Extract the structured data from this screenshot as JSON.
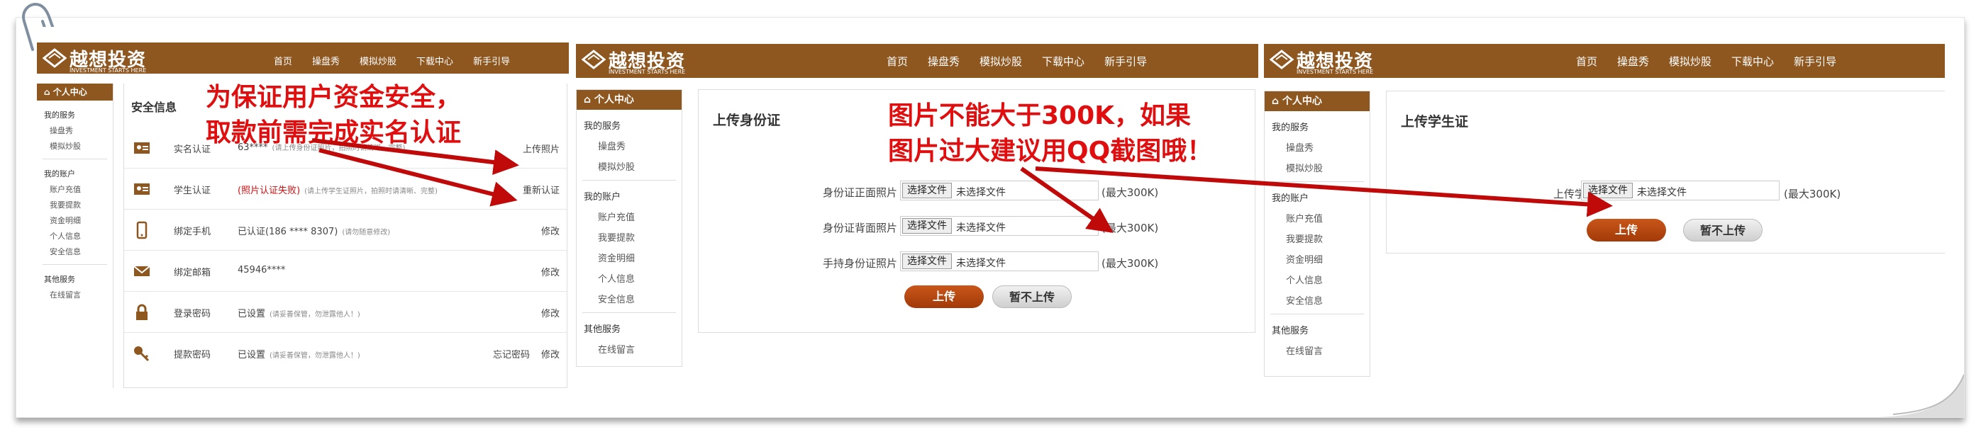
{
  "brand": {
    "name": "越想投资",
    "slogan": "INVESTMENT STARTS HERE",
    "color": "#8e5720"
  },
  "nav": [
    "首页",
    "操盘秀",
    "模拟炒股",
    "下载中心",
    "新手引导"
  ],
  "sidebar": {
    "header": "个人中心",
    "groups": [
      {
        "title": "我的服务",
        "items": [
          "操盘秀",
          "模拟炒股"
        ]
      },
      {
        "title": "我的账户",
        "items": [
          "账户充值",
          "我要提款",
          "资金明细",
          "个人信息",
          "安全信息"
        ]
      },
      {
        "title": "其他服务",
        "items": [
          "在线留言"
        ]
      }
    ]
  },
  "security": {
    "title": "安全信息",
    "rows": [
      {
        "icon": "id-card-icon",
        "label": "实名认证",
        "value": "63****",
        "note": "(请上传身份证照片，拍照时请清晰、完整)",
        "action": "上传照片"
      },
      {
        "icon": "student-card-icon",
        "label": "学生认证",
        "value": "(照片认证失败)",
        "note": "(请上传学生证照片，拍照时请清晰、完整)",
        "action": "重新认证"
      },
      {
        "icon": "phone-icon",
        "label": "绑定手机",
        "value": "已认证(186 **** 8307)",
        "note": "(请勿随意修改)",
        "action": "修改"
      },
      {
        "icon": "mail-icon",
        "label": "绑定邮箱",
        "value": "45946****",
        "note": "",
        "action": "修改"
      },
      {
        "icon": "lock-icon",
        "label": "登录密码",
        "value": "已设置",
        "note": "(请妥善保管，勿泄露他人！)",
        "action": "修改"
      },
      {
        "icon": "key-icon",
        "label": "提款密码",
        "value": "已设置",
        "note": "(请妥善保管，勿泄露他人！)",
        "action": "修改",
        "action2": "忘记密码"
      }
    ]
  },
  "id_upload": {
    "title": "上传身份证",
    "fields": [
      {
        "label": "身份证正面照片",
        "button": "选择文件",
        "status": "未选择文件",
        "max": "(最大300K)"
      },
      {
        "label": "身份证背面照片",
        "button": "选择文件",
        "status": "未选择文件",
        "max": "(最大300K)"
      },
      {
        "label": "手持身份证照片",
        "button": "选择文件",
        "status": "未选择文件",
        "max": "(最大300K)"
      }
    ],
    "upload": "上传",
    "skip": "暂不上传"
  },
  "student_upload": {
    "title": "上传学生证",
    "field": {
      "label": "上传学生证",
      "button": "选择文件",
      "status": "未选择文件",
      "max": "(最大300K)"
    },
    "upload": "上传",
    "skip": "暂不上传"
  },
  "annotations": {
    "note1_line1": "为保证用户资金安全，",
    "note1_line2": "取款前需完成实名认证",
    "note2_line1": "图片不能大于300K，如果",
    "note2_line2": "图片过大建议用QQ截图哦！",
    "color": "#e00e0e"
  }
}
